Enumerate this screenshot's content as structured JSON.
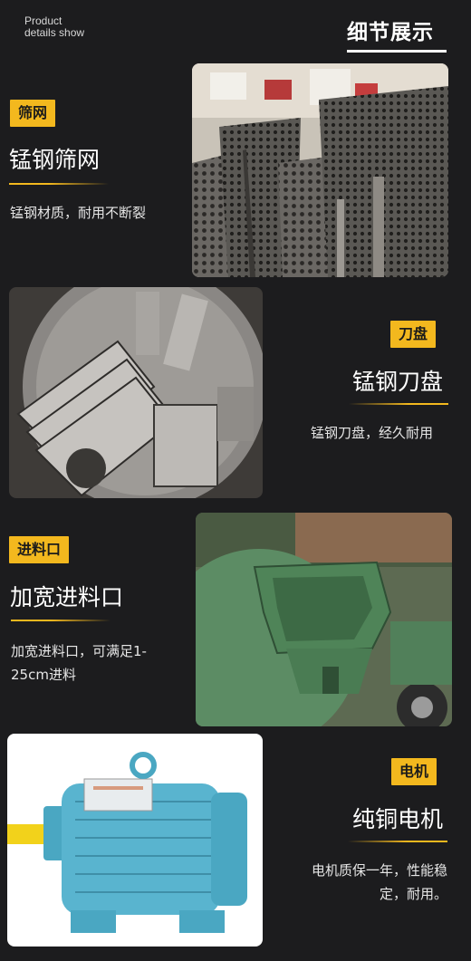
{
  "header": {
    "en_line1": "Product",
    "en_line2": "details show",
    "zh_title": "细节展示"
  },
  "sections": [
    {
      "tag": "筛网",
      "heading": "锰钢筛网",
      "desc": "锰钢材质，耐用不断裂"
    },
    {
      "tag": "刀盘",
      "heading": "锰钢刀盘",
      "desc": "锰钢刀盘，经久耐用"
    },
    {
      "tag": "进料口",
      "heading": "加宽进料口",
      "desc_line1": "加宽进料口，可满足1-",
      "desc_line2": "25cm进料"
    },
    {
      "tag": "电机",
      "heading": "纯铜电机",
      "desc_line1": "电机质保一年，性能稳",
      "desc_line2": "定，耐用。"
    }
  ],
  "colors": {
    "accent": "#f3b81e",
    "background": "#1c1c1e",
    "text": "#ffffff"
  }
}
